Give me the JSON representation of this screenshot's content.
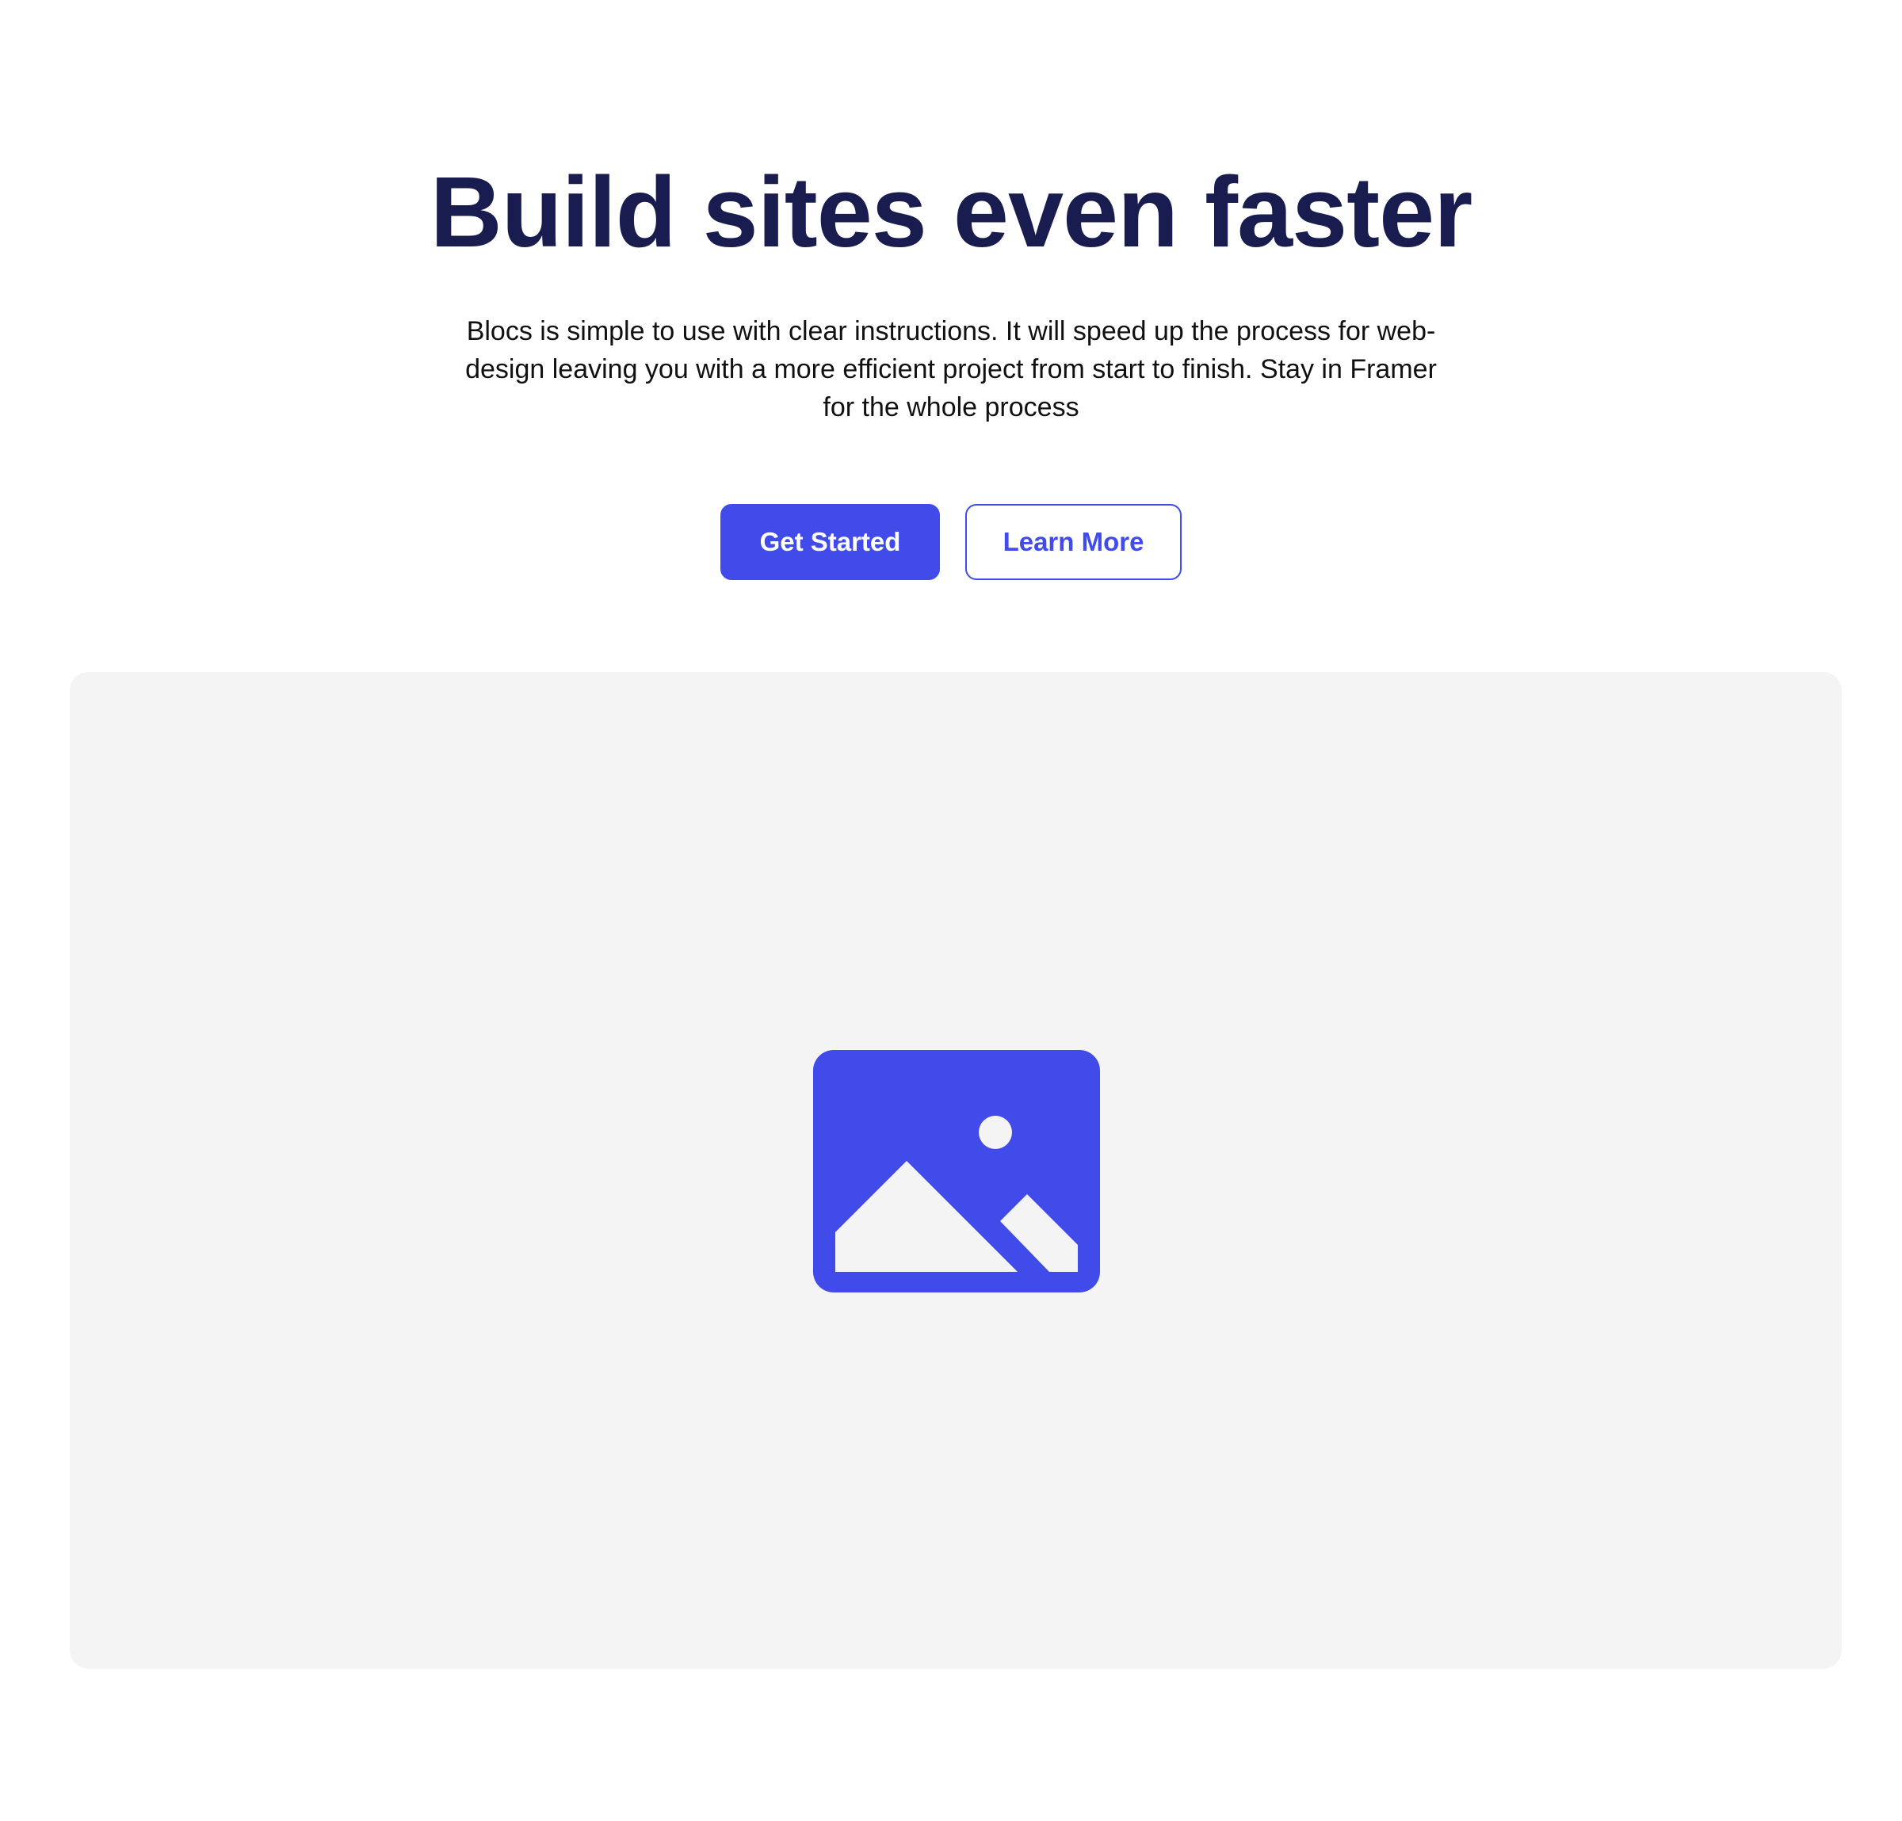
{
  "hero": {
    "title": "Build sites even faster",
    "subtitle": "Blocs is simple to use with clear instructions. It will speed up the process for web-design leaving you with a more efficient project from start to finish. Stay in Framer for the whole process",
    "primary_button_label": "Get Started",
    "secondary_button_label": "Learn More"
  },
  "media": {
    "icon": "image-placeholder-icon"
  },
  "colors": {
    "accent": "#414bea",
    "title": "#191c4f",
    "media_background": "#f4f4f4"
  }
}
